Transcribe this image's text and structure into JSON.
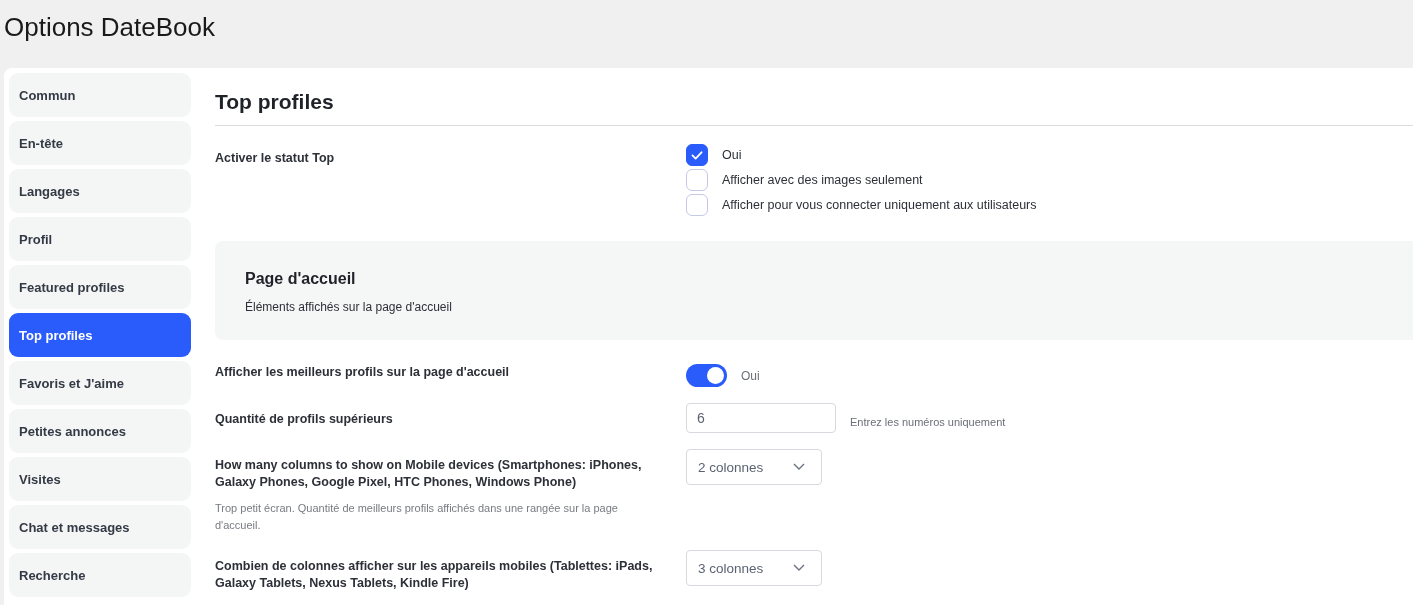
{
  "window": {
    "title": "Options DateBook"
  },
  "sidebar": {
    "items": [
      {
        "label": "Commun",
        "selected": false
      },
      {
        "label": "En-tête",
        "selected": false
      },
      {
        "label": "Langages",
        "selected": false
      },
      {
        "label": "Profil",
        "selected": false
      },
      {
        "label": "Featured profiles",
        "selected": false
      },
      {
        "label": "Top profiles",
        "selected": true
      },
      {
        "label": "Favoris et J'aime",
        "selected": false
      },
      {
        "label": "Petites annonces",
        "selected": false
      },
      {
        "label": "Visites",
        "selected": false
      },
      {
        "label": "Chat et messages",
        "selected": false
      },
      {
        "label": "Recherche",
        "selected": false
      }
    ]
  },
  "content": {
    "heading": "Top profiles",
    "top_settings": [
      {
        "kind": "checkboxes",
        "label": "Activer le statut Top",
        "options": [
          {
            "label": "Oui",
            "checked": true
          },
          {
            "label": "Afficher avec des images seulement",
            "checked": false
          },
          {
            "label": "Afficher pour vous connecter uniquement aux utilisateurs",
            "checked": false
          }
        ]
      }
    ],
    "section": {
      "title": "Page d'accueil",
      "subtitle": "Éléments affichés sur la page d'accueil"
    },
    "settings": [
      {
        "kind": "toggle",
        "label": "Afficher les meilleurs profils sur la page d'accueil",
        "on": true,
        "value_label": "Oui"
      },
      {
        "kind": "number",
        "label": "Quantité de profils supérieurs",
        "value": "6",
        "hint": "Entrez les numéros uniquement"
      },
      {
        "kind": "select",
        "label": "How many columns to show on Mobile devices (Smartphones: iPhones, Galaxy Phones, Google Pixel, HTC Phones, Windows Phone)",
        "value": "2 colonnes",
        "description": "Trop petit écran. Quantité de meilleurs profils affichés dans une rangée sur la page d'accueil."
      },
      {
        "kind": "select",
        "label": "Combien de colonnes afficher sur les appareils mobiles (Tablettes: iPads, Galaxy Tablets, Nexus Tablets, Kindle Fire)",
        "value": "3 colonnes"
      }
    ]
  }
}
